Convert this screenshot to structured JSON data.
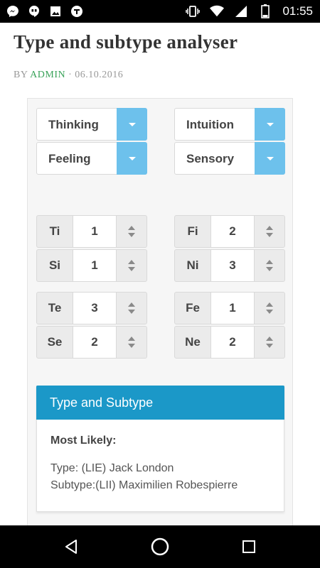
{
  "status_bar": {
    "time": "01:55",
    "left_icons": [
      "messenger-icon",
      "hangouts-icon",
      "image-icon",
      "app-icon"
    ],
    "right_icons": [
      "vibrate-icon",
      "wifi-icon",
      "signal-icon",
      "battery-icon"
    ]
  },
  "page": {
    "title": "Type and subtype analyser",
    "byline_prefix": "BY",
    "author": "ADMIN",
    "separator": "·",
    "date": "06.10.2016"
  },
  "selects": [
    {
      "label": "Thinking"
    },
    {
      "label": "Intuition"
    },
    {
      "label": "Feeling"
    },
    {
      "label": "Sensory"
    }
  ],
  "functions": [
    {
      "label": "Ti",
      "value": "1"
    },
    {
      "label": "Fi",
      "value": "2"
    },
    {
      "label": "Si",
      "value": "1"
    },
    {
      "label": "Ni",
      "value": "3"
    },
    {
      "label": "Te",
      "value": "3"
    },
    {
      "label": "Fe",
      "value": "1"
    },
    {
      "label": "Se",
      "value": "2"
    },
    {
      "label": "Ne",
      "value": "2"
    }
  ],
  "result": {
    "heading": "Type and Subtype",
    "most_likely": "Most Likely:",
    "type_line": "Type: (LIE) Jack London",
    "subtype_line": "Subtype:(LII) Maximilien Robespierre"
  },
  "colors": {
    "accent": "#6dc1ec",
    "panel_header": "#1b98c8",
    "author": "#3aa35a"
  }
}
